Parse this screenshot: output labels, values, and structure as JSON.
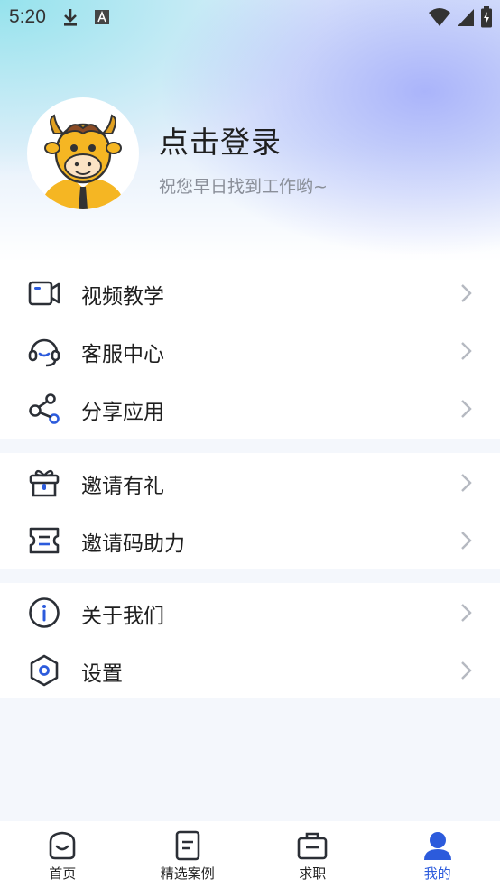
{
  "status_bar": {
    "time": "5:20",
    "download_icon": "download-icon",
    "a_icon": "font-a-icon",
    "wifi_icon": "wifi-icon",
    "signal_icon": "signal-icon",
    "battery_icon": "battery-charging-icon"
  },
  "profile": {
    "avatar_icon": "cartoon-bull-avatar",
    "title": "点击登录",
    "subtitle": "祝您早日找到工作哟~"
  },
  "menu": {
    "groups": [
      [
        {
          "label": "视频教学",
          "icon": "video-camera-icon"
        },
        {
          "label": "客服中心",
          "icon": "headset-icon"
        },
        {
          "label": "分享应用",
          "icon": "share-icon"
        }
      ],
      [
        {
          "label": "邀请有礼",
          "icon": "gift-icon"
        },
        {
          "label": "邀请码助力",
          "icon": "ticket-icon"
        }
      ],
      [
        {
          "label": "关于我们",
          "icon": "info-icon"
        },
        {
          "label": "设置",
          "icon": "settings-hexagon-icon"
        }
      ]
    ]
  },
  "tab_bar": {
    "tabs": [
      {
        "label": "首页",
        "icon": "home-smile-icon"
      },
      {
        "label": "精选案例",
        "icon": "document-icon"
      },
      {
        "label": "求职",
        "icon": "briefcase-icon"
      },
      {
        "label": "我的",
        "icon": "user-icon",
        "active": true
      }
    ]
  },
  "colors": {
    "accent": "#2c5bdc",
    "icon_stroke": "#2b2f36",
    "chevron": "#b5b9c1",
    "background": "#f4f7fc"
  }
}
